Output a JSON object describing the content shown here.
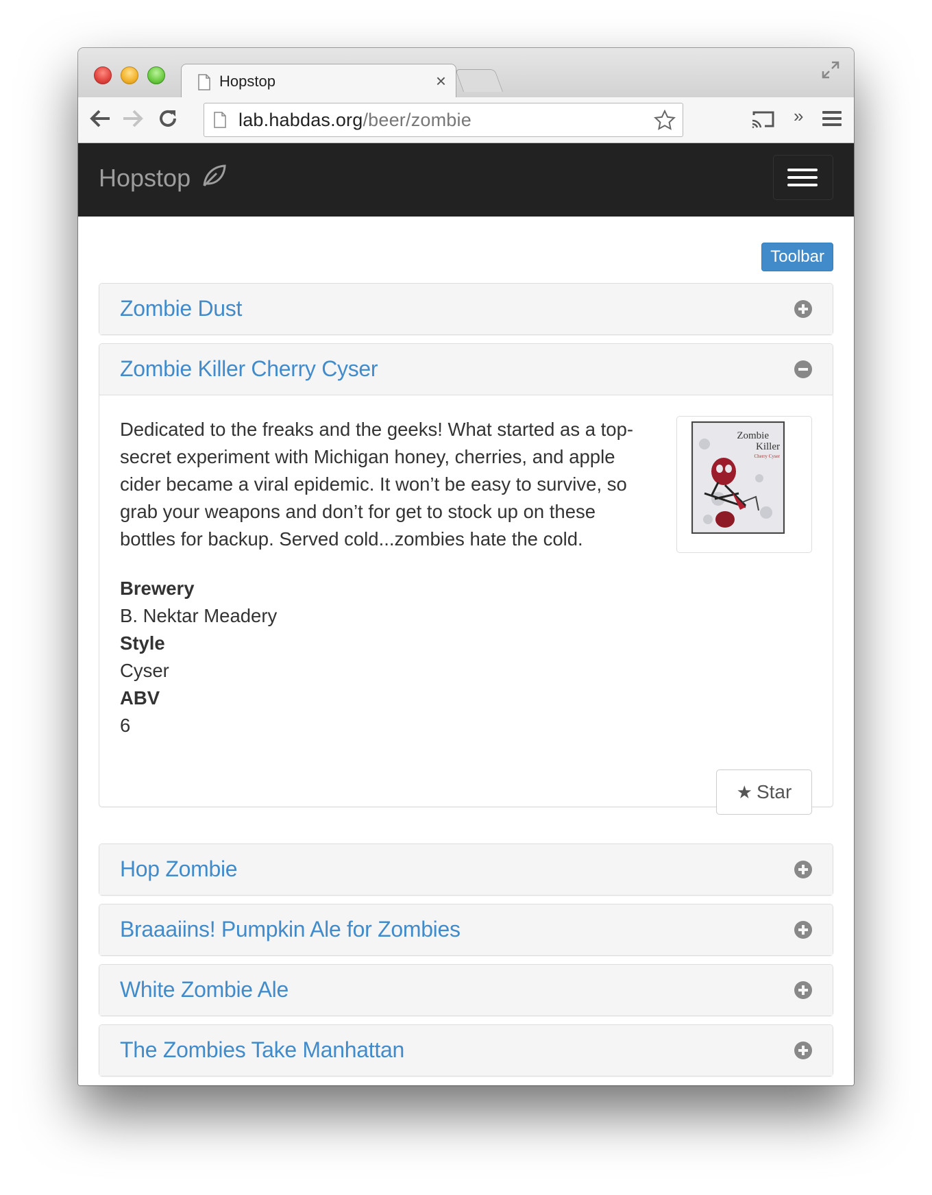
{
  "browser": {
    "tab_title": "Hopstop",
    "tab_close": "×",
    "url_host": "lab.habdas.org",
    "url_path": "/beer/zombie",
    "extensions_more": "»"
  },
  "navbar": {
    "brand": "Hopstop",
    "brand_icon": "leaf-icon"
  },
  "toolbar_button": "Toolbar",
  "beers": [
    {
      "name": "Zombie Dust",
      "expanded": false
    },
    {
      "name": "Zombie Killer Cherry Cyser",
      "expanded": true,
      "description": "Dedicated to the freaks and the geeks! What started as a top-secret experiment with Michigan honey, cherries, and apple cider became a viral epidemic. It won’t be easy to survive, so grab your weapons and don’t for get to stock up on these bottles for backup. Served cold...zombies hate the cold.",
      "label_title": [
        "Zombie",
        "Killer",
        "Cherry Cyser"
      ],
      "details": {
        "brewery_label": "Brewery",
        "brewery": "B. Nektar Meadery",
        "style_label": "Style",
        "style": "Cyser",
        "abv_label": "ABV",
        "abv": "6"
      },
      "star_label": "Star",
      "star_glyph": "★"
    },
    {
      "name": "Hop Zombie",
      "expanded": false
    },
    {
      "name": "Braaaiins! Pumpkin Ale for Zombies",
      "expanded": false
    },
    {
      "name": "White Zombie Ale",
      "expanded": false
    },
    {
      "name": "The Zombies Take Manhattan",
      "expanded": false
    }
  ],
  "colors": {
    "link": "#428bca",
    "navbar_bg": "#222222",
    "toolbar_btn": "#428bca"
  }
}
